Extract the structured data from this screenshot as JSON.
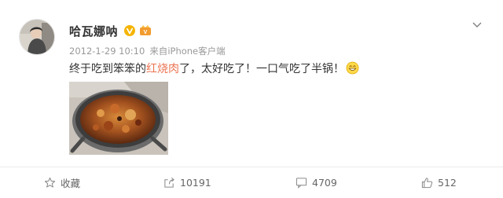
{
  "post": {
    "username": "哈瓦娜呐",
    "timestamp": "2012-1-29 10:10",
    "source_prefix": "来自",
    "source": "iPhone客户端",
    "text_before": "终于吃到笨笨的",
    "text_highlight": "红烧肉",
    "text_after": "了，太好吃了！一口气吃了半锅！",
    "highlight_color": "#eb7350",
    "emoji": "smile-emoji"
  },
  "actions": {
    "favorite_label": "收藏",
    "share_count": "10191",
    "comment_count": "4709",
    "like_count": "512"
  },
  "icons": [
    "chevron-down-icon",
    "vip-v-icon",
    "member-badge-icon",
    "star-icon",
    "share-icon",
    "comment-icon",
    "thumbs-up-icon"
  ]
}
